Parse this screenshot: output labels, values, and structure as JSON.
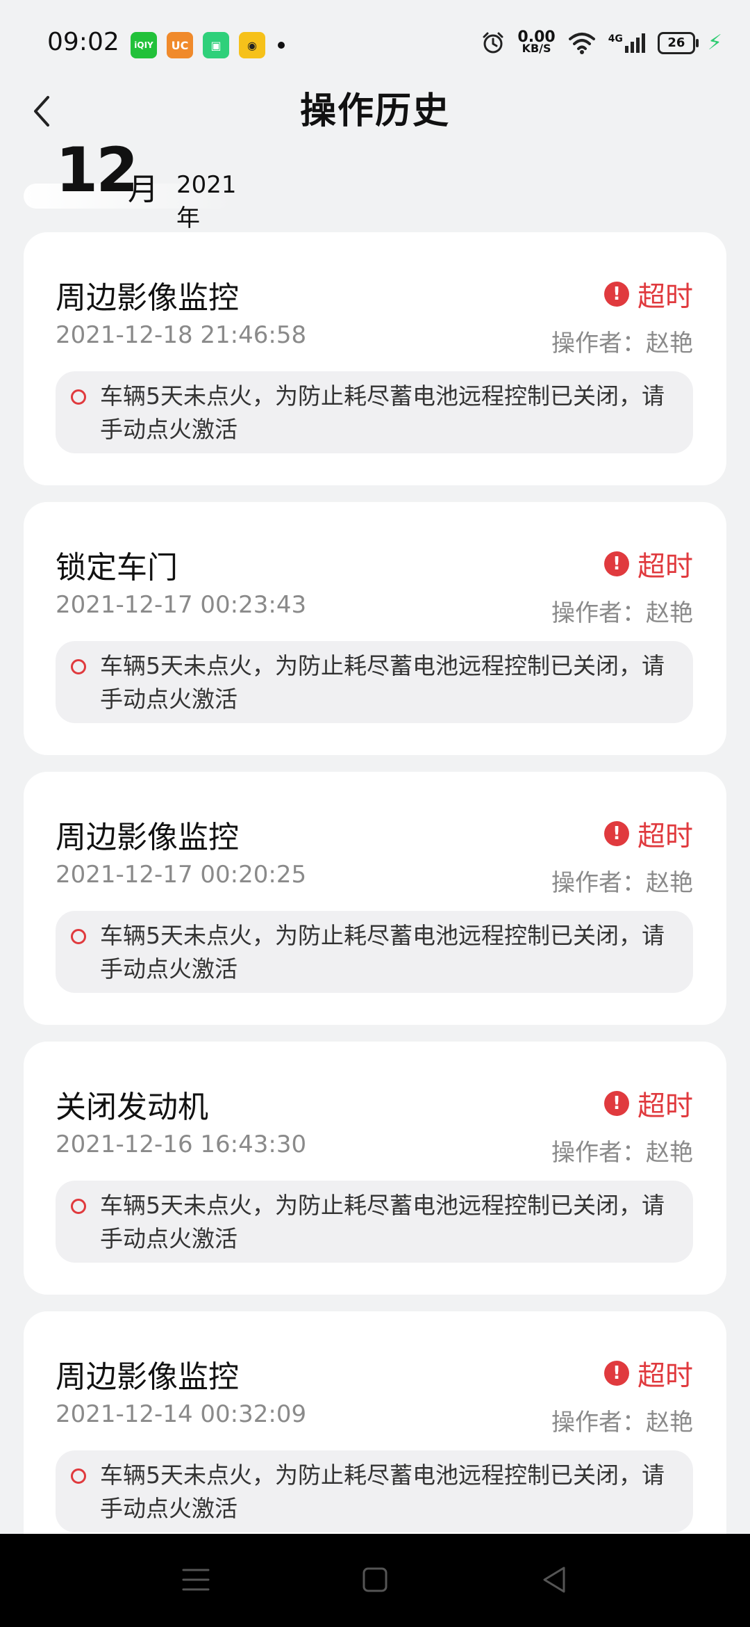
{
  "status_bar": {
    "time": "09:02",
    "apps": [
      {
        "name": "iqiyi-app-icon",
        "color": "#22c13a",
        "text": "iQIY"
      },
      {
        "name": "uc-app-icon",
        "color": "#f08a2b",
        "text": "UC"
      },
      {
        "name": "store-app-icon",
        "color": "#2fd07a",
        "text": "▣"
      },
      {
        "name": "car-app-icon",
        "color": "#f6c11a",
        "text": "◉"
      }
    ],
    "net_speed_value": "0.00",
    "net_speed_unit": "KB/S",
    "signal_label": "4G",
    "battery": "26"
  },
  "header": {
    "title": "操作历史"
  },
  "month_header": {
    "month": "12",
    "month_unit": "月",
    "year": "2021年"
  },
  "records": [
    {
      "title": "周边影像监控",
      "time": "2021-12-18 21:46:58",
      "status": "超时",
      "operator": "操作者：赵艳",
      "message": "车辆5天未点火，为防止耗尽蓄电池远程控制已关闭，请手动点火激活"
    },
    {
      "title": "锁定车门",
      "time": "2021-12-17 00:23:43",
      "status": "超时",
      "operator": "操作者：赵艳",
      "message": "车辆5天未点火，为防止耗尽蓄电池远程控制已关闭，请手动点火激活"
    },
    {
      "title": "周边影像监控",
      "time": "2021-12-17 00:20:25",
      "status": "超时",
      "operator": "操作者：赵艳",
      "message": "车辆5天未点火，为防止耗尽蓄电池远程控制已关闭，请手动点火激活"
    },
    {
      "title": "关闭发动机",
      "time": "2021-12-16 16:43:30",
      "status": "超时",
      "operator": "操作者：赵艳",
      "message": "车辆5天未点火，为防止耗尽蓄电池远程控制已关闭，请手动点火激活"
    },
    {
      "title": "周边影像监控",
      "time": "2021-12-14 00:32:09",
      "status": "超时",
      "operator": "操作者：赵艳",
      "message": "车辆5天未点火，为防止耗尽蓄电池远程控制已关闭，请手动点火激活"
    }
  ],
  "colors": {
    "accent_red": "#e03a3e",
    "background": "#f1f2f3",
    "card": "#ffffff"
  }
}
